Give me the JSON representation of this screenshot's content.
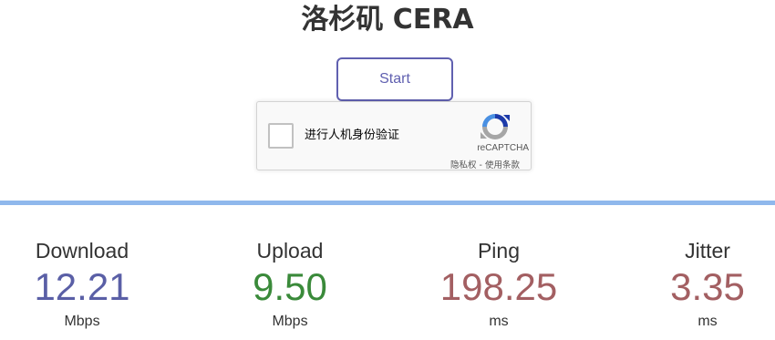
{
  "header": {
    "title": "洛杉矶 CERA"
  },
  "controls": {
    "start_label": "Start"
  },
  "recaptcha": {
    "label": "进行人机身份验证",
    "brand": "reCAPTCHA",
    "privacy_label": "隐私权",
    "separator": " - ",
    "terms_label": "使用条款"
  },
  "results": {
    "download": {
      "label": "Download",
      "value": "12.21",
      "unit": "Mbps",
      "color": "#5a5fa6"
    },
    "upload": {
      "label": "Upload",
      "value": "9.50",
      "unit": "Mbps",
      "color": "#3a8a3a"
    },
    "ping": {
      "label": "Ping",
      "value": "198.25",
      "unit": "ms",
      "color": "#a35f62"
    },
    "jitter": {
      "label": "Jitter",
      "value": "3.35",
      "unit": "ms",
      "color": "#a35f62"
    }
  },
  "colors": {
    "accent": "#6060b0",
    "divider": "#8fb8ec"
  }
}
